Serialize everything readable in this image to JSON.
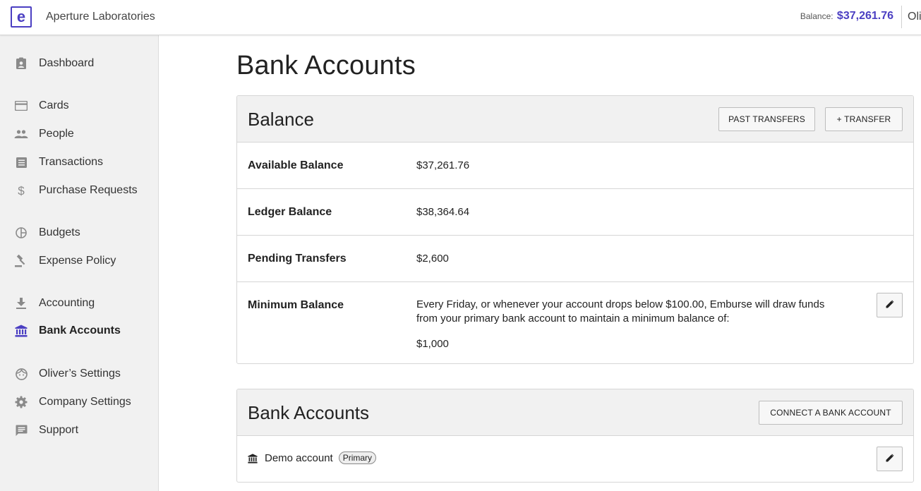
{
  "header": {
    "logo_letter": "e",
    "company": "Aperture Laboratories",
    "balance_label": "Balance:",
    "balance_value": "$37,261.76",
    "user_name": "Oli"
  },
  "sidebar": {
    "items": [
      {
        "label": "Dashboard",
        "icon": "clipboard-icon"
      },
      {
        "label": "Cards",
        "icon": "credit-card-icon"
      },
      {
        "label": "People",
        "icon": "people-icon"
      },
      {
        "label": "Transactions",
        "icon": "list-icon"
      },
      {
        "label": "Purchase Requests",
        "icon": "dollar-icon"
      },
      {
        "label": "Budgets",
        "icon": "pie-chart-icon"
      },
      {
        "label": "Expense Policy",
        "icon": "gavel-icon"
      },
      {
        "label": "Accounting",
        "icon": "download-icon"
      },
      {
        "label": "Bank Accounts",
        "icon": "bank-icon",
        "active": true
      },
      {
        "label": "Oliver’s Settings",
        "icon": "face-icon"
      },
      {
        "label": "Company Settings",
        "icon": "gear-icon"
      },
      {
        "label": "Support",
        "icon": "chat-icon"
      }
    ]
  },
  "main": {
    "title": "Bank Accounts",
    "balance_panel": {
      "title": "Balance",
      "past_transfers_label": "PAST TRANSFERS",
      "transfer_label": "+ TRANSFER",
      "rows": [
        {
          "label": "Available Balance",
          "value": "$37,261.76"
        },
        {
          "label": "Ledger Balance",
          "value": "$38,364.64"
        },
        {
          "label": "Pending Transfers",
          "value": "$2,600"
        }
      ],
      "minimum": {
        "label": "Minimum Balance",
        "description_line1": "Every Friday, or whenever your account drops below $100.00, Emburse will draw funds",
        "description_line2": "from your primary bank account to maintain a minimum balance of:",
        "value": "$1,000"
      }
    },
    "bank_panel": {
      "title": "Bank Accounts",
      "connect_label": "CONNECT A BANK ACCOUNT",
      "account_name": "Demo account",
      "account_badge": "Primary"
    }
  },
  "colors": {
    "accent": "#4b3fc2",
    "sidebar_bg": "#f1f1f1",
    "icon_gray": "#8a8a8a"
  }
}
